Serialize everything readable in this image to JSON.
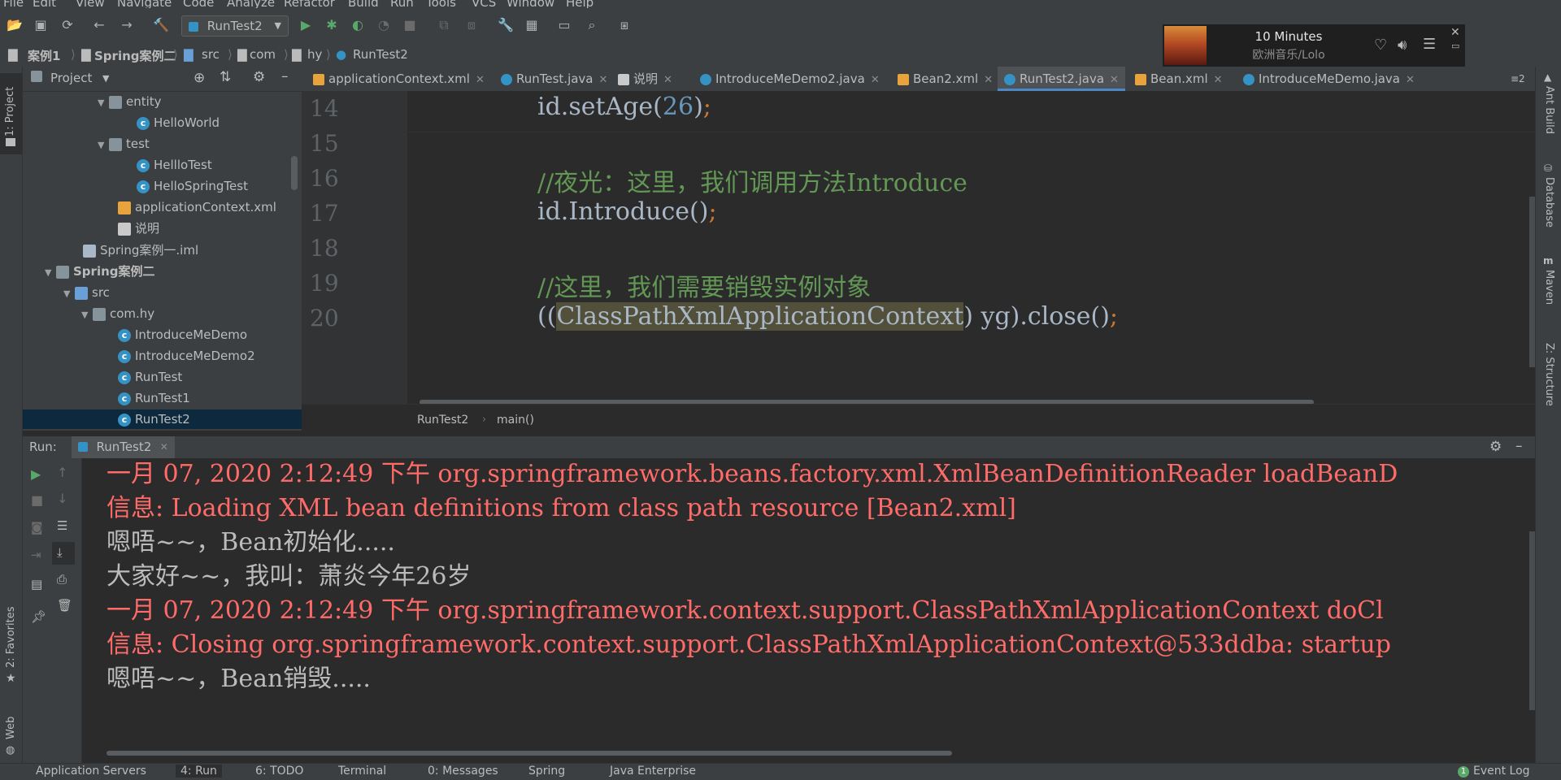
{
  "menu": [
    "File",
    "Edit",
    "View",
    "Navigate",
    "Code",
    "Analyze",
    "Refactor",
    "Build",
    "Run",
    "Tools",
    "VCS",
    "Window",
    "Help"
  ],
  "toolbar": {
    "run_config": "RunTest2"
  },
  "breadcrumb": [
    "案例1",
    "Spring案例二",
    "src",
    "com",
    "hy",
    "RunTest2"
  ],
  "music": {
    "title": "10 Minutes",
    "artist": "欧洲音乐/Lolo"
  },
  "left_stripe": {
    "project": "1: Project",
    "favorites": "2: Favorites",
    "web": "Web"
  },
  "right_stripe": [
    "Ant Build",
    "Database",
    "Maven",
    "Z: Structure"
  ],
  "project_panel": {
    "title": "Project",
    "items": [
      {
        "label": "entity",
        "type": "folder"
      },
      {
        "label": "HelloWorld",
        "type": "class"
      },
      {
        "label": "test",
        "type": "folder"
      },
      {
        "label": "HellloTest",
        "type": "class"
      },
      {
        "label": "HelloSpringTest",
        "type": "class"
      },
      {
        "label": "applicationContext.xml",
        "type": "xml"
      },
      {
        "label": "说明",
        "type": "text"
      },
      {
        "label": "Spring案例一.iml",
        "type": "iml"
      },
      {
        "label": "Spring案例二",
        "type": "module"
      },
      {
        "label": "src",
        "type": "src"
      },
      {
        "label": "com.hy",
        "type": "package"
      },
      {
        "label": "IntroduceMeDemo",
        "type": "class"
      },
      {
        "label": "IntroduceMeDemo2",
        "type": "class"
      },
      {
        "label": "RunTest",
        "type": "class"
      },
      {
        "label": "RunTest1",
        "type": "class"
      },
      {
        "label": "RunTest2",
        "type": "class"
      }
    ]
  },
  "tabs": [
    {
      "label": "applicationContext.xml",
      "type": "xml"
    },
    {
      "label": "RunTest.java",
      "type": "class"
    },
    {
      "label": "说明",
      "type": "text"
    },
    {
      "label": "IntroduceMeDemo2.java",
      "type": "class"
    },
    {
      "label": "Bean2.xml",
      "type": "xml"
    },
    {
      "label": "RunTest2.java",
      "type": "class",
      "active": true
    },
    {
      "label": "Bean.xml",
      "type": "xml"
    },
    {
      "label": "IntroduceMeDemo.java",
      "type": "class"
    }
  ],
  "tabs_overflow": "≡2",
  "editor": {
    "line_numbers": [
      "14",
      "15",
      "16",
      "17",
      "18",
      "19",
      "20"
    ],
    "line14": {
      "a": "id.setAge(",
      "num": "26",
      "b": ")",
      "semi": ";"
    },
    "line16_comment": "//夜光：这里，我们调用方法Introduce",
    "line17": {
      "a": "id.Introduce()",
      "semi": ";"
    },
    "line19_comment": "//这里，我们需要销毁实例对象",
    "line20": {
      "a": "((",
      "hl": "ClassPathXmlApplicationContext",
      "b": ") yg).close()",
      "semi": ";"
    },
    "breadcrumb": [
      "RunTest2",
      "main()"
    ]
  },
  "run_panel": {
    "label": "Run:",
    "tab": "RunTest2",
    "lines": [
      {
        "text": "一月 07, 2020 2:12:49 下午 org.springframework.beans.factory.xml.XmlBeanDefinitionReader loadBeanD",
        "kind": "err"
      },
      {
        "text": "信息: Loading XML bean definitions from class path resource [Bean2.xml]",
        "kind": "err"
      },
      {
        "text": "嗯唔~~，Bean初始化.....",
        "kind": "out"
      },
      {
        "text": "大家好~~，我叫：萧炎今年26岁",
        "kind": "out"
      },
      {
        "text": "一月 07, 2020 2:12:49 下午 org.springframework.context.support.ClassPathXmlApplicationContext doCl",
        "kind": "err"
      },
      {
        "text": "信息: Closing org.springframework.context.support.ClassPathXmlApplicationContext@533ddba: startup",
        "kind": "err"
      },
      {
        "text": "嗯唔~~，Bean销毁.....",
        "kind": "out"
      }
    ]
  },
  "bottom_bar": {
    "items": [
      "Application Servers",
      "4: Run",
      "6: TODO",
      "Terminal",
      "0: Messages",
      "Spring",
      "Java Enterprise"
    ],
    "event_log": "Event Log",
    "event_count": "1"
  }
}
